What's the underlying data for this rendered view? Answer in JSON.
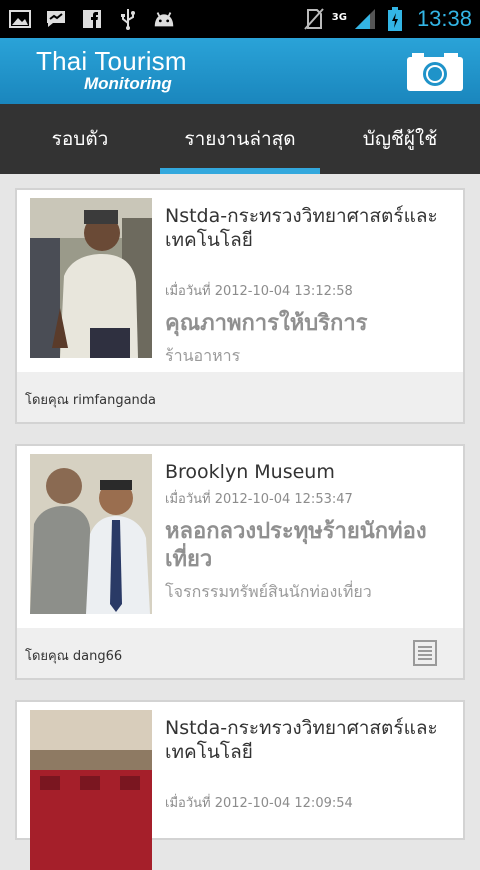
{
  "app": {
    "title_line1": "Thai Tourism",
    "title_line2": "Monitoring"
  },
  "status_bar": {
    "time": "13:38",
    "network": "3G",
    "icons": [
      "image-icon",
      "chat-icon",
      "facebook-icon",
      "usb-icon",
      "android-icon",
      "no-sim-icon",
      "signal-icon",
      "battery-icon"
    ]
  },
  "tabs": [
    {
      "label": "รอบตัว",
      "active": false
    },
    {
      "label": "รายงานล่าสุด",
      "active": true
    },
    {
      "label": "บัญชีผู้ใช้",
      "active": false
    }
  ],
  "reports": [
    {
      "title": "Nstda-กระทรวงวิทยาศาสตร์และเทคโนโลยี",
      "date": "เมื่อวันที่ 2012-10-04 13:12:58",
      "headline": "คุณภาพการให้บริการ",
      "category": "ร้านอาหาร",
      "by": "โดยคุณ rimfanganda"
    },
    {
      "title": "Brooklyn Museum",
      "date": "เมื่อวันที่ 2012-10-04 12:53:47",
      "headline": "หลอกลวงประทุษร้ายนักท่องเที่ยว",
      "category": "โจรกรรมทรัพย์สินนักท่องเที่ยว",
      "by": "โดยคุณ dang66"
    },
    {
      "title": "Nstda-กระทรวงวิทยาศาสตร์และเทคโนโลยี",
      "date": "เมื่อวันที่ 2012-10-04 12:09:54"
    }
  ],
  "colors": {
    "accent": "#33a8dd",
    "header": "#1f93c9",
    "tabbar": "#333333",
    "clock": "#33b5e5"
  }
}
